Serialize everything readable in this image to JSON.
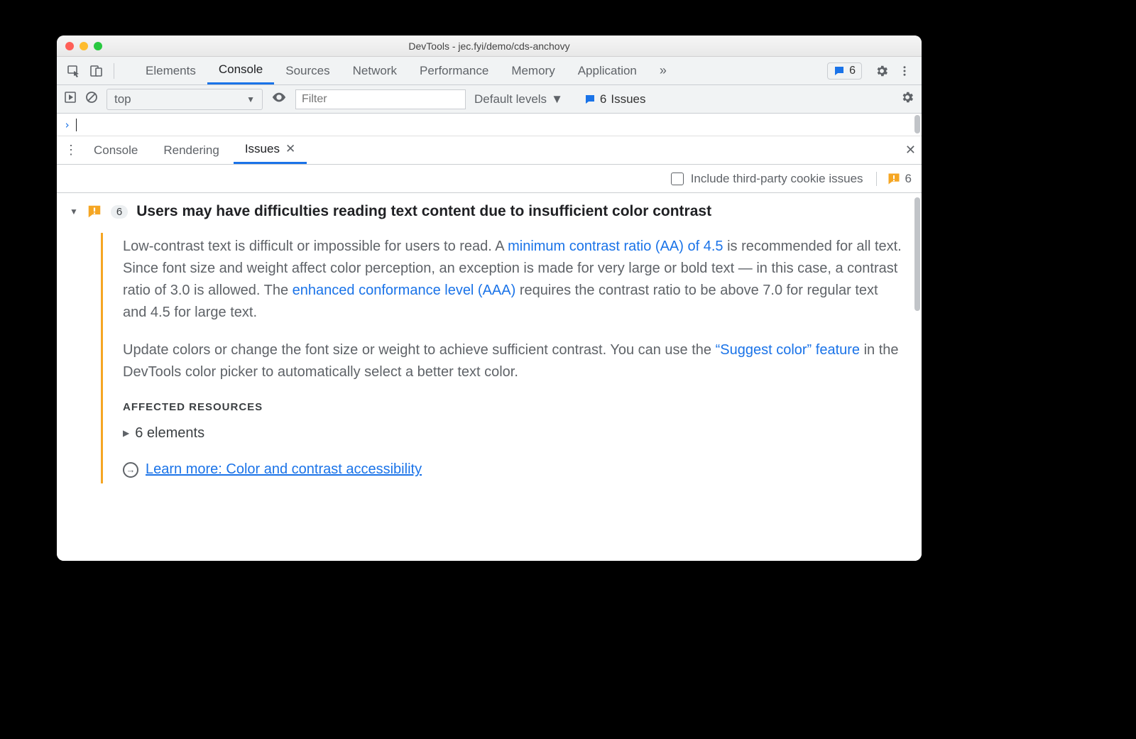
{
  "window": {
    "title": "DevTools - jec.fyi/demo/cds-anchovy"
  },
  "mainTabs": {
    "items": [
      "Elements",
      "Console",
      "Sources",
      "Network",
      "Performance",
      "Memory",
      "Application"
    ],
    "activeIndex": 1,
    "overflowGlyph": "»",
    "issuesBadge": {
      "count": "6"
    }
  },
  "consoleToolbar": {
    "contextLabel": "top",
    "filterPlaceholder": "Filter",
    "levelsLabel": "Default levels",
    "issuesLink": {
      "count": "6",
      "label": "Issues"
    }
  },
  "prompt": {
    "glyph": "›"
  },
  "drawer": {
    "tabs": [
      {
        "label": "Console"
      },
      {
        "label": "Rendering"
      },
      {
        "label": "Issues",
        "closable": true
      }
    ],
    "activeIndex": 2,
    "sub": {
      "includeThirdParty": "Include third-party cookie issues",
      "warnCount": "6"
    }
  },
  "issue": {
    "count": "6",
    "title": "Users may have difficulties reading text content due to insufficient color contrast",
    "p1a": "Low-contrast text is difficult or impossible for users to read. A ",
    "link1": "minimum contrast ratio (AA) of 4.5",
    "p1b": " is recommended for all text. Since font size and weight affect color perception, an exception is made for very large or bold text — in this case, a contrast ratio of 3.0 is allowed. The ",
    "link2": "enhanced conformance level (AAA)",
    "p1c": " requires the contrast ratio to be above 7.0 for regular text and 4.5 for large text.",
    "p2a": "Update colors or change the font size or weight to achieve sufficient contrast. You can use the ",
    "link3": "“Suggest color” feature",
    "p2b": " in the DevTools color picker to automatically select a better text color.",
    "affectedHeader": "AFFECTED RESOURCES",
    "affectedRow": "6 elements",
    "learnMore": "Learn more: Color and contrast accessibility"
  }
}
